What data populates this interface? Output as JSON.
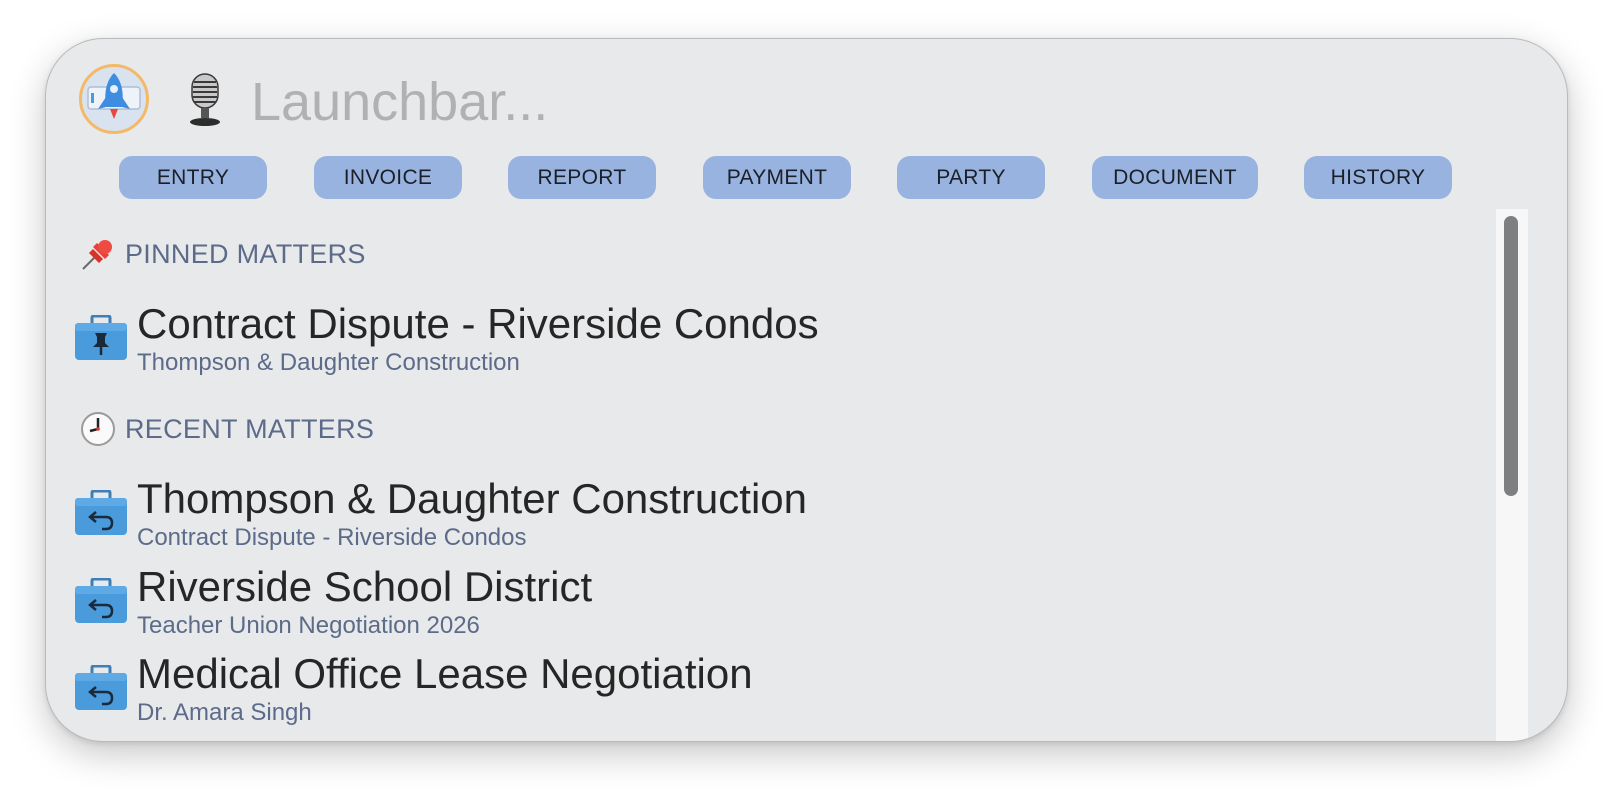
{
  "search": {
    "placeholder": "Launchbar..."
  },
  "icons": {
    "app": "rocket-app-icon",
    "mic": "microphone-icon",
    "pinned_header": "pushpin-icon",
    "recent_header": "clock-icon",
    "pinned_item": "briefcase-pin-icon",
    "recent_item": "briefcase-undo-icon"
  },
  "chips": [
    {
      "label": "ENTRY"
    },
    {
      "label": "INVOICE"
    },
    {
      "label": "REPORT"
    },
    {
      "label": "PAYMENT"
    },
    {
      "label": "PARTY"
    },
    {
      "label": "DOCUMENT"
    },
    {
      "label": "HISTORY"
    }
  ],
  "pinned": {
    "header": "PINNED MATTERS",
    "items": [
      {
        "title": "Contract Dispute - Riverside Condos",
        "subtitle": "Thompson & Daughter Construction"
      }
    ]
  },
  "recent": {
    "header": "RECENT MATTERS",
    "items": [
      {
        "title": "Thompson & Daughter Construction",
        "subtitle": "Contract Dispute - Riverside Condos"
      },
      {
        "title": "Riverside School District",
        "subtitle": "Teacher Union Negotiation 2026"
      },
      {
        "title": "Medical Office Lease Negotiation",
        "subtitle": "Dr. Amara Singh"
      }
    ]
  },
  "colors": {
    "window_bg": "#e8e9ea",
    "chip_bg": "#98b3e0",
    "section_text": "#5d6b8a",
    "briefcase_blue": "#4a9bdc"
  }
}
